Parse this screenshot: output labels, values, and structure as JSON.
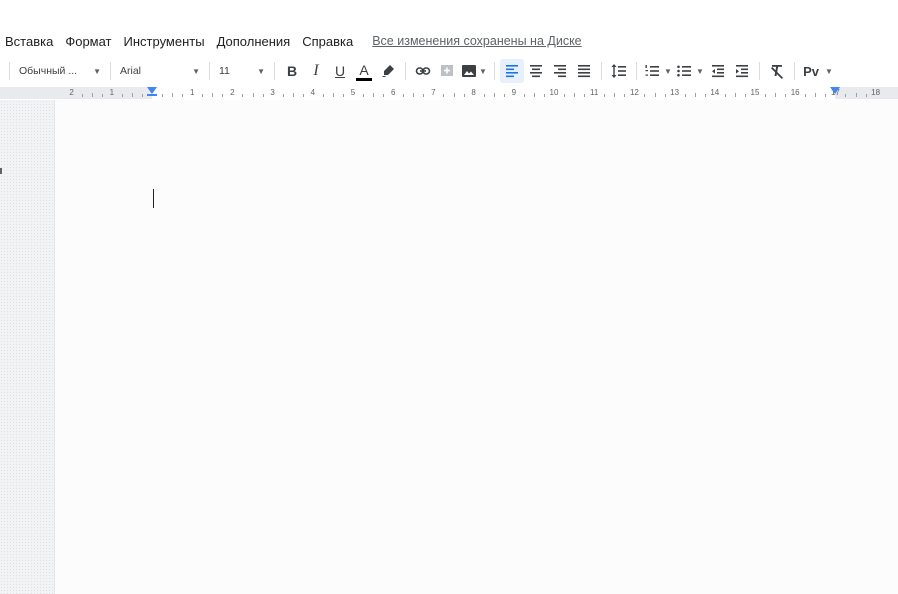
{
  "menu": {
    "items": [
      "Вставка",
      "Формат",
      "Инструменты",
      "Дополнения",
      "Справка"
    ],
    "save_status": "Все изменения сохранены на Диске"
  },
  "toolbar": {
    "style": "Обычный ...",
    "font": "Arial",
    "font_size": "11",
    "bold": "B",
    "italic": "I",
    "underline": "U",
    "text_color": "A",
    "input_tools": "Рv",
    "icons": {
      "dropdown": "caret-down-icon",
      "highlight": "highlighter-icon",
      "link": "link-icon",
      "comment": "add-comment-icon",
      "image": "image-icon",
      "align_left": "align-left-icon",
      "align_center": "align-center-icon",
      "align_right": "align-right-icon",
      "align_justify": "align-justify-icon",
      "line_spacing": "line-spacing-icon",
      "numbered_list": "numbered-list-icon",
      "bulleted_list": "bulleted-list-icon",
      "decrease_indent": "decrease-indent-icon",
      "increase_indent": "increase-indent-icon",
      "clear_formatting": "clear-formatting-icon"
    },
    "colors": {
      "active_align": "#1a73e8",
      "active_bg": "#e8f0fe"
    }
  },
  "ruler": {
    "labels": [
      "2",
      "1",
      "1",
      "2",
      "3",
      "4",
      "5",
      "6",
      "7",
      "8",
      "9",
      "10",
      "11",
      "12",
      "13",
      "14",
      "15",
      "16",
      "17",
      "18"
    ],
    "colors": {
      "marker": "#4285f4"
    }
  }
}
